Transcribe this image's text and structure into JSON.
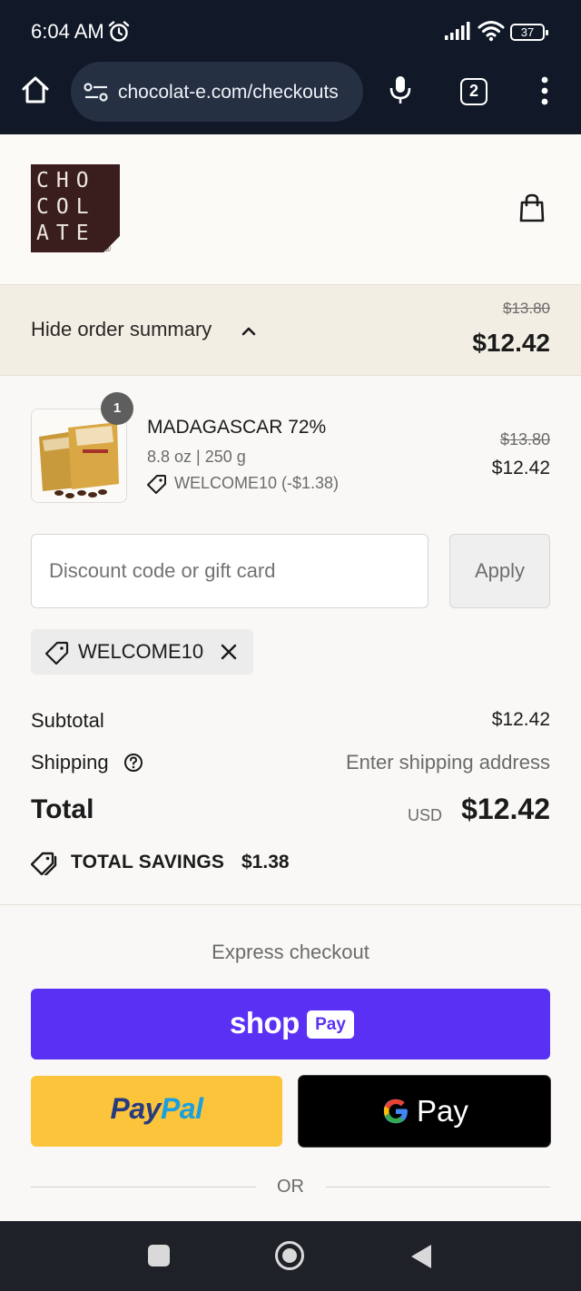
{
  "status_bar": {
    "time": "6:04 AM",
    "battery": "37",
    "icons": [
      "alarm-icon",
      "signal-icon",
      "wifi-icon",
      "battery-icon"
    ]
  },
  "browser": {
    "url": "chocolat-e.com/checkouts",
    "tab_count": "2",
    "icons": [
      "home-icon",
      "tune-icon",
      "mic-icon",
      "tabs-icon",
      "more-vert-icon"
    ]
  },
  "header": {
    "logo_text": "CHOCOLATE",
    "logo_registered": "®",
    "icons": [
      "shopping-bag-icon"
    ]
  },
  "order_summary": {
    "toggle_label": "Hide order summary",
    "original_total": "$13.80",
    "total": "$12.42"
  },
  "line_items": [
    {
      "quantity": "1",
      "name": "MADAGASCAR 72%",
      "variant": "8.8 oz | 250 g",
      "discount": "WELCOME10 (-$1.38)",
      "original_price": "$13.80",
      "price": "$12.42"
    }
  ],
  "discount": {
    "placeholder": "Discount code or gift card",
    "value": "",
    "apply_label": "Apply",
    "applied_code": "WELCOME10"
  },
  "totals": {
    "subtotal_label": "Subtotal",
    "subtotal_value": "$12.42",
    "shipping_label": "Shipping",
    "shipping_value": "Enter shipping address",
    "total_label": "Total",
    "currency": "USD",
    "total_value": "$12.42",
    "savings_label": "TOTAL SAVINGS",
    "savings_value": "$1.38"
  },
  "express": {
    "title": "Express checkout",
    "shoppay_word": "shop",
    "shoppay_pay": "Pay",
    "paypal_part1": "Pay",
    "paypal_part2": "Pal",
    "gpay_word": "Pay",
    "or_label": "OR"
  },
  "colors": {
    "shop_pay": "#5a31f4",
    "paypal": "#fcc43a",
    "gpay": "#000000",
    "summary_bg": "#f3eee4",
    "logo_bg": "#3a1e1e"
  }
}
